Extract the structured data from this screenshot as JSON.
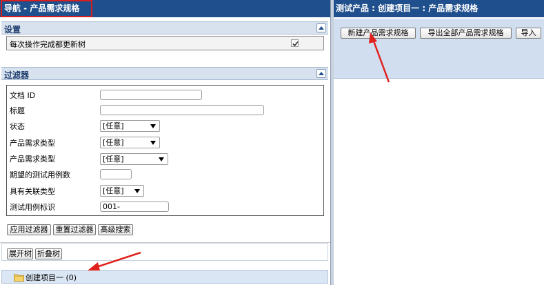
{
  "left_pane": {
    "title": "导航 - 产品需求规格",
    "settings": {
      "title": "设置",
      "option_label": "每次操作完成都更新树",
      "option_checked": true
    },
    "filters": {
      "title": "过滤器",
      "rows": [
        {
          "label": "文档 ID",
          "type": "text",
          "value": ""
        },
        {
          "label": "标题",
          "type": "text",
          "value": ""
        },
        {
          "label": "状态",
          "type": "select",
          "value": "[任意]"
        },
        {
          "label": "产品需求类型",
          "type": "select",
          "value": "[任意]"
        },
        {
          "label": "产品需求类型",
          "type": "select",
          "value": "[任意]"
        },
        {
          "label": "期望的测试用例数",
          "type": "text",
          "value": ""
        },
        {
          "label": "具有关联类型",
          "type": "select",
          "value": "[任意]"
        },
        {
          "label": "测试用例标识",
          "type": "text",
          "value": "001-"
        }
      ],
      "buttons": {
        "apply": "应用过滤器",
        "reset": "重置过滤器",
        "advanced": "高级搜索"
      }
    },
    "tree": {
      "expand": "展开树",
      "collapse": "折叠树",
      "node_label": "创建项目一 (0)"
    }
  },
  "right_pane": {
    "title": "测试产品 : 创建项目一 : 产品需求规格",
    "buttons": {
      "create": "新建产品需求规格",
      "export_all": "导出全部产品需求规格",
      "import": "导入"
    }
  },
  "colors": {
    "header_blue": "#1f4f8c",
    "highlight_red": "#d61f1f",
    "toolbar_blue": "#d1deef"
  },
  "icons": [
    "collapse-up-icon",
    "checkmark-icon",
    "dropdown-arrow-icon",
    "folder-icon"
  ]
}
